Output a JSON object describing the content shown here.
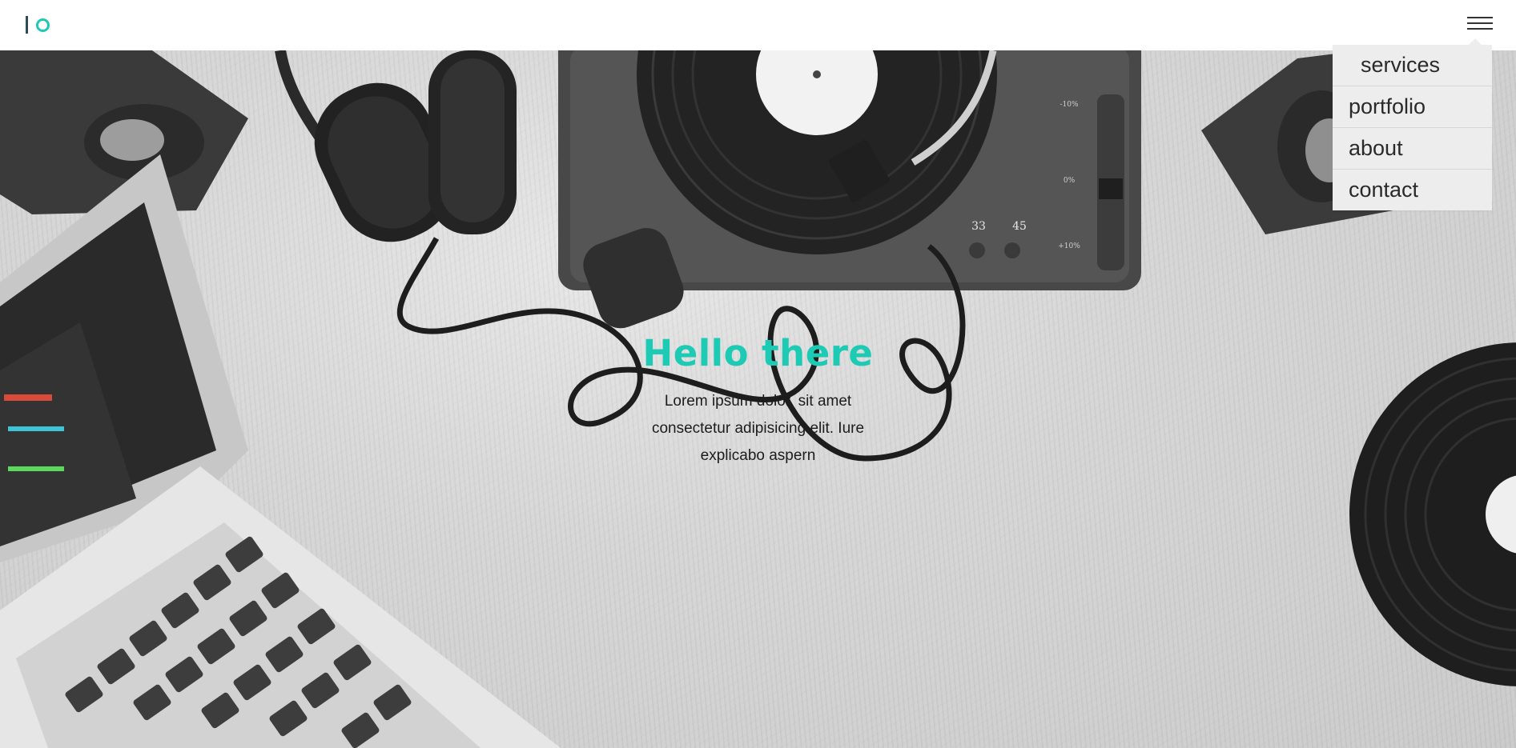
{
  "header": {
    "logo_icon": "io-logo",
    "menu_icon": "hamburger-menu-icon",
    "brand_color": "#1fc8b3"
  },
  "menu": {
    "items": [
      {
        "label": "services"
      },
      {
        "label": "portfolio"
      },
      {
        "label": "about"
      },
      {
        "label": "contact"
      }
    ]
  },
  "hero": {
    "title": "Hello there",
    "subtitle": "Lorem ipsum dolor, sit amet consectetur adipisicing elit. Iure explicabo aspern",
    "title_color": "#1dcab3",
    "turntable": {
      "speed_labels": [
        "33",
        "45"
      ],
      "pitch_labels": [
        "-10%",
        "0%",
        "+10%"
      ]
    }
  }
}
